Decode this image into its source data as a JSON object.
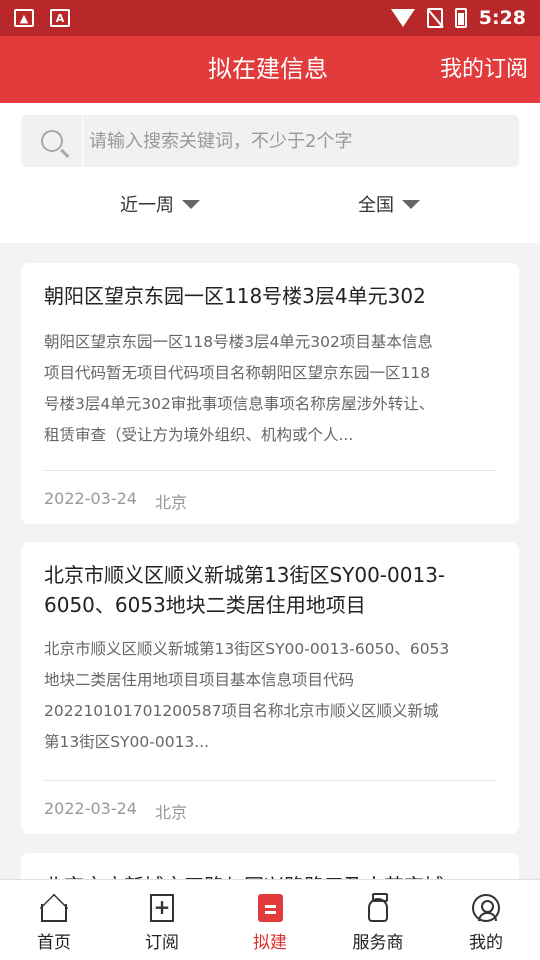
{
  "status_bar": {
    "time": "5:28",
    "icons": [
      "image-icon",
      "a-icon",
      "wifi-icon",
      "no-sim-icon",
      "battery-icon"
    ]
  },
  "header": {
    "title": "拟在建信息",
    "subscribe_link": "我的订阅"
  },
  "search": {
    "placeholder": "请输入搜索关键词，不少于2个字",
    "value": ""
  },
  "filters": {
    "period": "近一周",
    "region": "全国"
  },
  "cards": [
    {
      "title": "朝阳区望京东园一区118号楼3层4单元302",
      "body": [
        "朝阳区望京东园一区118号楼3层4单元302项目基本信息",
        "项目代码暂无项目代码项目名称朝阳区望京东园一区118",
        "号楼3层4单元302审批事项信息事项名称房屋涉外转让、",
        "租赁审查（受让方为境外组织、机构或个人..."
      ],
      "date": "2022-03-24",
      "location": "北京"
    },
    {
      "title": "北京市顺义区顺义新城第13街区SY00-0013-6050、6053地块二类居住用地项目",
      "body": [
        "北京市顺义区顺义新城第13街区SY00-0013-6050、6053",
        "地块二类居住用地项目项目基本信息项目代码",
        "202210101701200587项目名称北京市顺义区顺义新城",
        "第13街区SY00-0013..."
      ],
      "date": "2022-03-24",
      "location": "北京"
    },
    {
      "title": "北京亦庄新城亦四路与同兴路路口及中芯京城"
    }
  ],
  "tabs": [
    {
      "label": "首页",
      "icon": "home-icon"
    },
    {
      "label": "订阅",
      "icon": "subscribe-icon"
    },
    {
      "label": "拟建",
      "icon": "proposed-build-icon",
      "active": true
    },
    {
      "label": "服务商",
      "icon": "service-provider-icon"
    },
    {
      "label": "我的",
      "icon": "profile-icon"
    }
  ],
  "colors": {
    "header_red": "#e23b3b",
    "status_red": "#b8272a",
    "active_tab": "#d9302e"
  }
}
